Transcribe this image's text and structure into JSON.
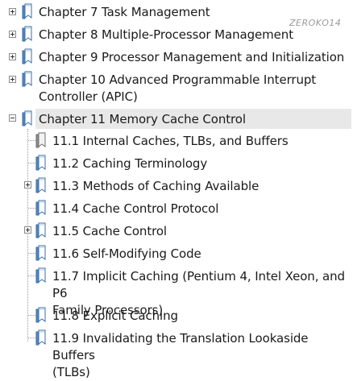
{
  "watermark": "ZEROKO14",
  "chapters": [
    {
      "label": "Chapter 7 Task Management",
      "state": "collapsed"
    },
    {
      "label": "Chapter 8 Multiple-Processor Management",
      "state": "collapsed"
    },
    {
      "label": "Chapter 9 Processor Management and Initialization",
      "state": "collapsed"
    },
    {
      "label": "Chapter 10 Advanced Programmable Interrupt\nController (APIC)",
      "state": "collapsed"
    },
    {
      "label": "Chapter 11 Memory Cache Control",
      "state": "expanded",
      "selected": true
    }
  ],
  "sections": [
    {
      "label": "11.1 Internal Caches, TLBs, and Buffers",
      "has_children": false,
      "icon": "bookmark-gray-icon"
    },
    {
      "label": "11.2 Caching Terminology",
      "has_children": false,
      "icon": "bookmark-icon"
    },
    {
      "label": "11.3 Methods of Caching Available",
      "has_children": true,
      "icon": "bookmark-icon"
    },
    {
      "label": "11.4 Cache Control Protocol",
      "has_children": false,
      "icon": "bookmark-icon"
    },
    {
      "label": "11.5 Cache Control",
      "has_children": true,
      "icon": "bookmark-icon"
    },
    {
      "label": "11.6 Self-Modifying Code",
      "has_children": false,
      "icon": "bookmark-icon"
    },
    {
      "label": "11.7 Implicit Caching (Pentium 4, Intel Xeon, and P6\nFamily Processors)",
      "has_children": false,
      "icon": "bookmark-icon"
    },
    {
      "label": "11.8 Explicit Caching",
      "has_children": false,
      "icon": "bookmark-icon"
    },
    {
      "label": "11.9 Invalidating the Translation Lookaside Buffers\n(TLBs)",
      "has_children": false,
      "icon": "bookmark-icon"
    }
  ]
}
